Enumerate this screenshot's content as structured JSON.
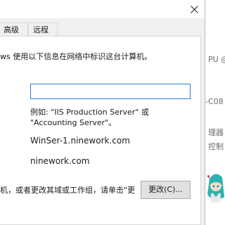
{
  "window": {
    "close_glyph": "✕"
  },
  "tabs": [
    {
      "label": "高级"
    },
    {
      "label": "远程"
    }
  ],
  "panel": {
    "intro": "ws 使用以下信息在网络中标识这台计算机。",
    "description_value": "",
    "example": "例如: \"IIS Production Server\" 或 \"Accounting Server\"。",
    "full_computer_name": "WinSer-1.ninework.com",
    "workgroup_domain": "ninework.com",
    "change_text": "机，或者更改其域或工作组，请单击\"更",
    "change_button": "更改(C)..."
  },
  "background": {
    "frag1": "PU @",
    "frag2": "-C08",
    "frag3": "理器",
    "frag4": "控制"
  },
  "colors": {
    "focus_border": "#2f7fd1",
    "dialog_bg": "#f0f0f0",
    "button_bg": "#e1e1e1"
  }
}
